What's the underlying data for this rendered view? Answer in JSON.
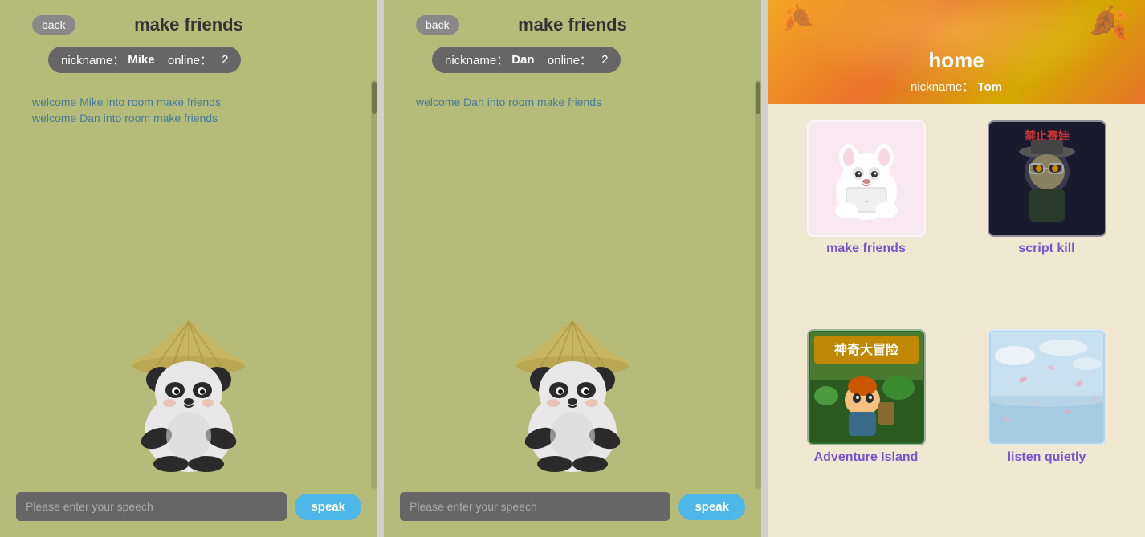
{
  "panel1": {
    "back_label": "back",
    "title": "make friends",
    "nickname_label": "nickname：",
    "nickname": "Mike",
    "online_label": "online：",
    "online_count": "2",
    "messages": [
      "welcome Mike into room make friends",
      "welcome Dan into room make friends"
    ],
    "speech_placeholder": "Please enter your speech",
    "speak_label": "speak"
  },
  "panel2": {
    "back_label": "back",
    "title": "make friends",
    "nickname_label": "nickname：",
    "nickname": "Dan",
    "online_label": "online：",
    "online_count": "2",
    "messages": [
      "welcome Dan into room make friends"
    ],
    "speech_placeholder": "Please enter your speech",
    "speak_label": "speak"
  },
  "home": {
    "title": "home",
    "nickname_label": "nickname：",
    "nickname": "Tom",
    "rooms": [
      {
        "id": "make-friends",
        "label": "make friends",
        "color": "#f9e8f0"
      },
      {
        "id": "script-kill",
        "label": "script kill",
        "color": "#1a1a2e"
      },
      {
        "id": "adventure-island",
        "label": "Adventure Island",
        "color": "#2d6a2d"
      },
      {
        "id": "listen-quietly",
        "label": "listen quietly",
        "color": "#b0d4e8"
      }
    ]
  },
  "icons": {
    "leaf": "🍂",
    "panda": "🐼"
  }
}
